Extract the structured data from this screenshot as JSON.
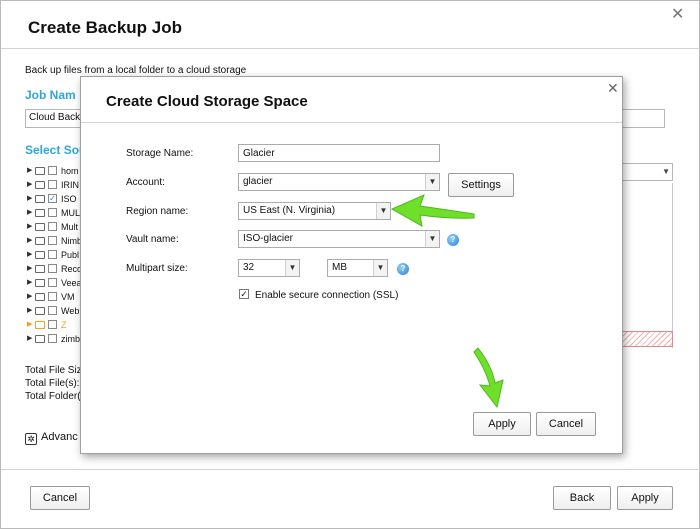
{
  "background_window": {
    "title": "Create Backup Job",
    "close_glyph": "✕",
    "description": "Back up files from a local folder to a cloud storage",
    "job_name_label": "Job Nam",
    "job_name_value": "Cloud Backu",
    "select_source_label": "Select Sou",
    "tree": [
      {
        "label": "hom",
        "checked": false
      },
      {
        "label": "IRIN",
        "checked": false
      },
      {
        "label": "ISO",
        "checked": true
      },
      {
        "label": "MUL",
        "checked": false
      },
      {
        "label": "Mult",
        "checked": false
      },
      {
        "label": "Nimb",
        "checked": false
      },
      {
        "label": "Publ",
        "checked": false
      },
      {
        "label": "Reco",
        "checked": false
      },
      {
        "label": "Veea",
        "checked": false
      },
      {
        "label": "VM",
        "checked": false
      },
      {
        "label": "Web",
        "checked": false
      },
      {
        "label": "Z",
        "checked": false,
        "highlight": "orange"
      },
      {
        "label": "zimb",
        "checked": false
      }
    ],
    "totals": {
      "file_size": "Total File Siz",
      "files": "Total File(s):",
      "folders": "Total Folder("
    },
    "advanced_label": "Advanc",
    "buttons": {
      "cancel": "Cancel",
      "back": "Back",
      "apply": "Apply"
    }
  },
  "modal": {
    "title": "Create Cloud Storage Space",
    "close_glyph": "✕",
    "fields": {
      "storage_name_label": "Storage Name:",
      "storage_name_value": "Glacier",
      "account_label": "Account:",
      "account_value": "glacier",
      "settings_button": "Settings",
      "region_label": "Region name:",
      "region_value": "US East (N. Virginia)",
      "vault_label": "Vault name:",
      "vault_value": "ISO-glacier",
      "multipart_label": "Multipart size:",
      "multipart_value": "32",
      "multipart_unit": "MB"
    },
    "ssl_label": "Enable secure connection (SSL)",
    "ssl_checked": true,
    "buttons": {
      "apply": "Apply",
      "cancel": "Cancel"
    }
  },
  "colors": {
    "accent_blue": "#2ea6dc",
    "arrow_green": "#6fe02a"
  },
  "icons": {
    "help": "help-circle-icon",
    "dropdown": "chevron-down-icon",
    "gear": "gear-icon"
  }
}
